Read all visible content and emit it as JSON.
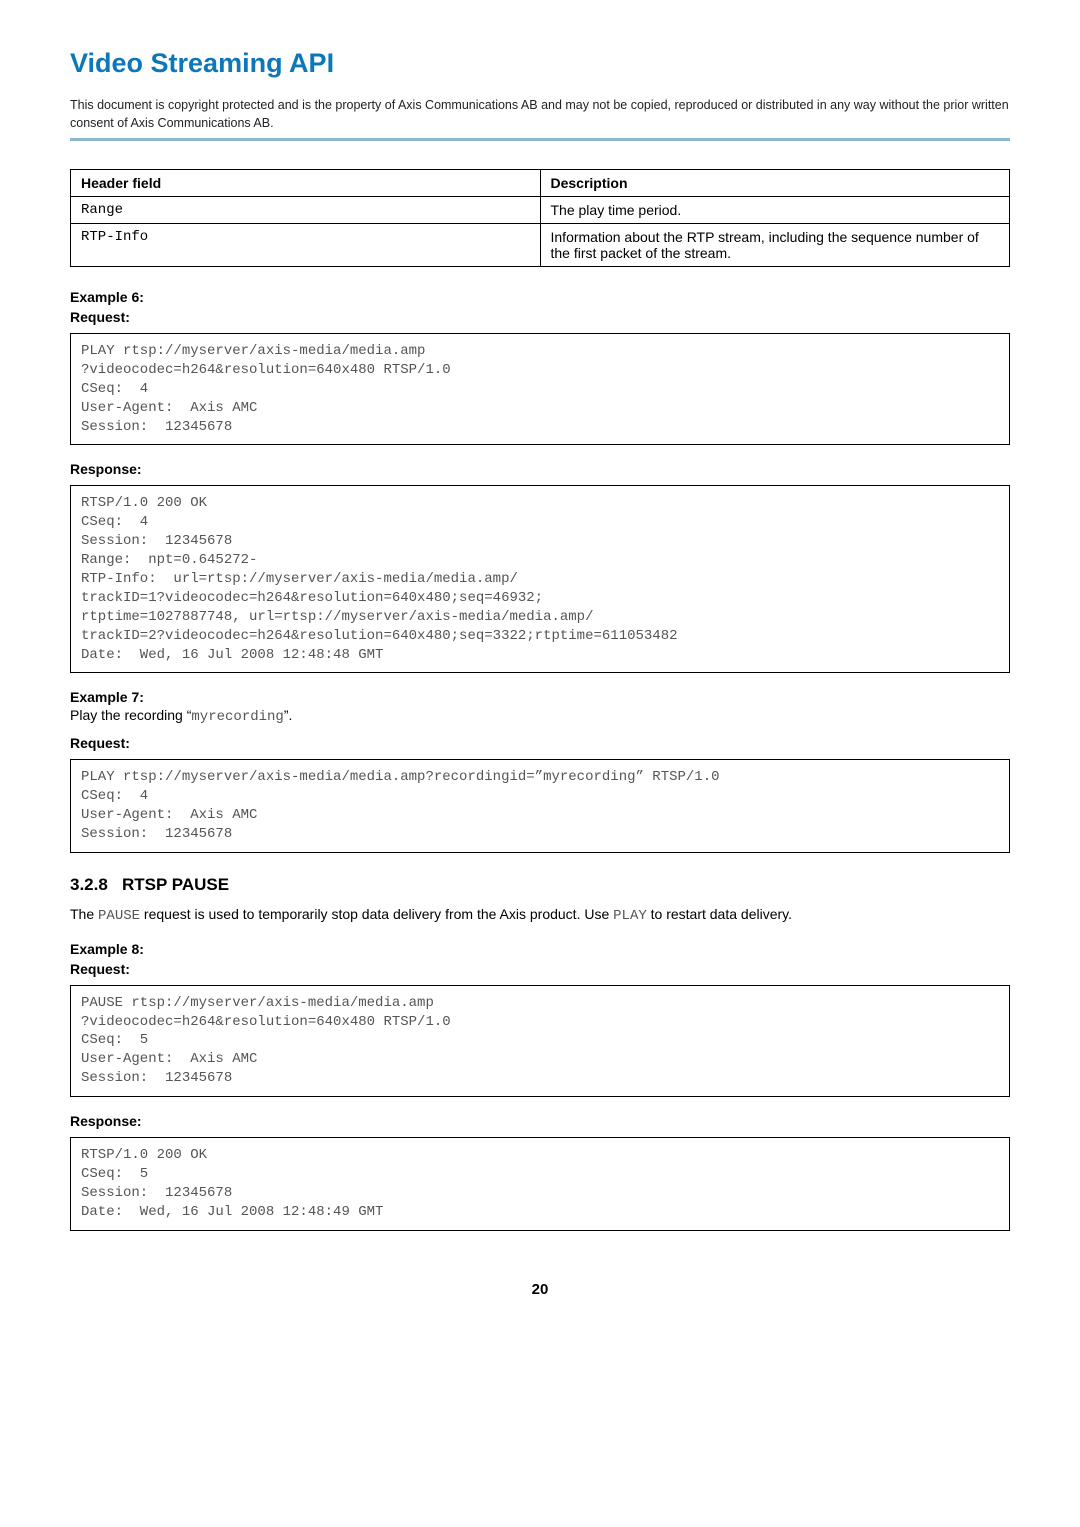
{
  "header": {
    "title": "Video Streaming API",
    "copyright": "This document is copyright protected and is the property of Axis Communications AB and may not be copied, reproduced or distributed in any way without the prior written consent of Axis Communications AB."
  },
  "table": {
    "head": {
      "c1": "Header field",
      "c2": "Description"
    },
    "rows": [
      {
        "c1": "Range",
        "c2": "The play time period."
      },
      {
        "c1": "RTP-Info",
        "c2": "Information about the RTP stream, including the sequence number of the first packet of the stream."
      }
    ]
  },
  "example6": {
    "label": "Example 6:",
    "request_label": "Request:",
    "request_code": "PLAY rtsp://myserver/axis-media/media.amp\n?videocodec=h264&resolution=640x480 RTSP/1.0\nCSeq:  4\nUser-Agent:  Axis AMC\nSession:  12345678",
    "response_label": "Response:",
    "response_code": "RTSP/1.0 200 OK\nCSeq:  4\nSession:  12345678\nRange:  npt=0.645272-\nRTP-Info:  url=rtsp://myserver/axis-media/media.amp/\ntrackID=1?videocodec=h264&resolution=640x480;seq=46932;\nrtptime=1027887748, url=rtsp://myserver/axis-media/media.amp/\ntrackID=2?videocodec=h264&resolution=640x480;seq=3322;rtptime=611053482\nDate:  Wed, 16 Jul 2008 12:48:48 GMT"
  },
  "example7": {
    "label": "Example 7:",
    "desc_prefix": "Play the recording “",
    "desc_mono": "myrecording",
    "desc_suffix": "”.",
    "request_label": "Request:",
    "request_code": "PLAY rtsp://myserver/axis-media/media.amp?recordingid=”myrecording” RTSP/1.0\nCSeq:  4\nUser-Agent:  Axis AMC\nSession:  12345678"
  },
  "section": {
    "num": "3.2.8",
    "title": "RTSP PAUSE",
    "para_a": "The ",
    "para_mono1": "PAUSE",
    "para_b": " request is used to temporarily stop data delivery from the Axis product. Use ",
    "para_mono2": "PLAY",
    "para_c": " to restart data delivery."
  },
  "example8": {
    "label": "Example 8:",
    "request_label": "Request:",
    "request_code": "PAUSE rtsp://myserver/axis-media/media.amp\n?videocodec=h264&resolution=640x480 RTSP/1.0\nCSeq:  5\nUser-Agent:  Axis AMC\nSession:  12345678",
    "response_label": "Response:",
    "response_code": "RTSP/1.0 200 OK\nCSeq:  5\nSession:  12345678\nDate:  Wed, 16 Jul 2008 12:48:49 GMT"
  },
  "page_number": "20"
}
